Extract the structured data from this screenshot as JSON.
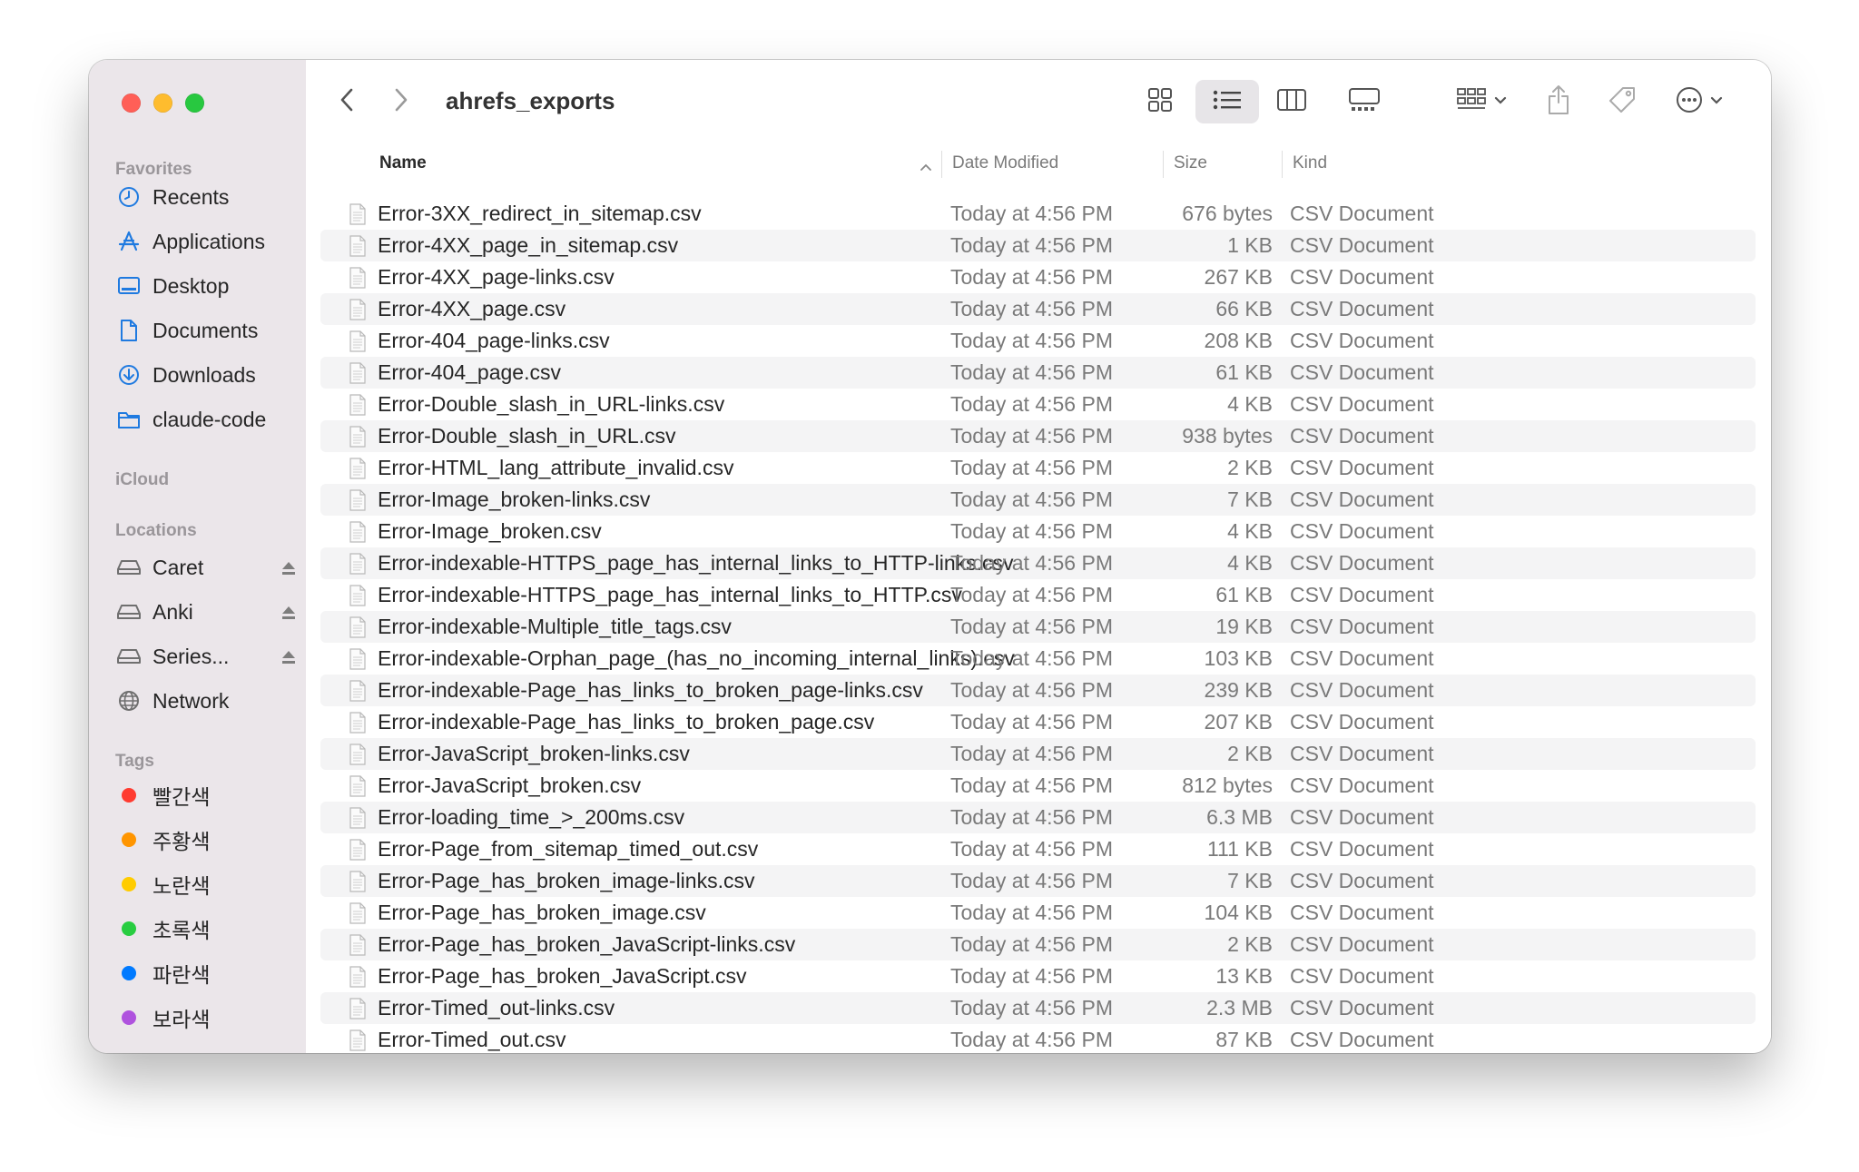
{
  "window": {
    "title": "ahrefs_exports"
  },
  "sidebar": {
    "favorites_label": "Favorites",
    "favorites": [
      {
        "label": "Recents",
        "icon": "clock-icon"
      },
      {
        "label": "Applications",
        "icon": "applications-icon"
      },
      {
        "label": "Desktop",
        "icon": "desktop-icon"
      },
      {
        "label": "Documents",
        "icon": "document-icon"
      },
      {
        "label": "Downloads",
        "icon": "download-icon"
      },
      {
        "label": "claude-code",
        "icon": "folder-icon"
      }
    ],
    "icloud_label": "iCloud",
    "locations_label": "Locations",
    "locations": [
      {
        "label": "Caret",
        "icon": "drive-icon",
        "ejectable": true
      },
      {
        "label": "Anki",
        "icon": "drive-icon",
        "ejectable": true
      },
      {
        "label": "Series...",
        "icon": "drive-icon",
        "ejectable": true
      },
      {
        "label": "Network",
        "icon": "globe-icon",
        "ejectable": false
      }
    ],
    "tags_label": "Tags",
    "tags": [
      {
        "label": "빨간색",
        "color": "#ff3b30"
      },
      {
        "label": "주황색",
        "color": "#ff9500"
      },
      {
        "label": "노란색",
        "color": "#ffcc00"
      },
      {
        "label": "초록색",
        "color": "#28cd41"
      },
      {
        "label": "파란색",
        "color": "#007aff"
      },
      {
        "label": "보라색",
        "color": "#af52de"
      }
    ]
  },
  "columns": {
    "name": "Name",
    "date": "Date Modified",
    "size": "Size",
    "kind": "Kind"
  },
  "files": [
    {
      "name": "Error-3XX_redirect_in_sitemap.csv",
      "date": "Today at 4:56 PM",
      "size": "676 bytes",
      "kind": "CSV Document"
    },
    {
      "name": "Error-4XX_page_in_sitemap.csv",
      "date": "Today at 4:56 PM",
      "size": "1 KB",
      "kind": "CSV Document"
    },
    {
      "name": "Error-4XX_page-links.csv",
      "date": "Today at 4:56 PM",
      "size": "267 KB",
      "kind": "CSV Document"
    },
    {
      "name": "Error-4XX_page.csv",
      "date": "Today at 4:56 PM",
      "size": "66 KB",
      "kind": "CSV Document"
    },
    {
      "name": "Error-404_page-links.csv",
      "date": "Today at 4:56 PM",
      "size": "208 KB",
      "kind": "CSV Document"
    },
    {
      "name": "Error-404_page.csv",
      "date": "Today at 4:56 PM",
      "size": "61 KB",
      "kind": "CSV Document"
    },
    {
      "name": "Error-Double_slash_in_URL-links.csv",
      "date": "Today at 4:56 PM",
      "size": "4 KB",
      "kind": "CSV Document"
    },
    {
      "name": "Error-Double_slash_in_URL.csv",
      "date": "Today at 4:56 PM",
      "size": "938 bytes",
      "kind": "CSV Document"
    },
    {
      "name": "Error-HTML_lang_attribute_invalid.csv",
      "date": "Today at 4:56 PM",
      "size": "2 KB",
      "kind": "CSV Document"
    },
    {
      "name": "Error-Image_broken-links.csv",
      "date": "Today at 4:56 PM",
      "size": "7 KB",
      "kind": "CSV Document"
    },
    {
      "name": "Error-Image_broken.csv",
      "date": "Today at 4:56 PM",
      "size": "4 KB",
      "kind": "CSV Document"
    },
    {
      "name": "Error-indexable-HTTPS_page_has_internal_links_to_HTTP-links.csv",
      "date": "Today at 4:56 PM",
      "size": "4 KB",
      "kind": "CSV Document"
    },
    {
      "name": "Error-indexable-HTTPS_page_has_internal_links_to_HTTP.csv",
      "date": "Today at 4:56 PM",
      "size": "61 KB",
      "kind": "CSV Document"
    },
    {
      "name": "Error-indexable-Multiple_title_tags.csv",
      "date": "Today at 4:56 PM",
      "size": "19 KB",
      "kind": "CSV Document"
    },
    {
      "name": "Error-indexable-Orphan_page_(has_no_incoming_internal_links).csv",
      "date": "Today at 4:56 PM",
      "size": "103 KB",
      "kind": "CSV Document"
    },
    {
      "name": "Error-indexable-Page_has_links_to_broken_page-links.csv",
      "date": "Today at 4:56 PM",
      "size": "239 KB",
      "kind": "CSV Document"
    },
    {
      "name": "Error-indexable-Page_has_links_to_broken_page.csv",
      "date": "Today at 4:56 PM",
      "size": "207 KB",
      "kind": "CSV Document"
    },
    {
      "name": "Error-JavaScript_broken-links.csv",
      "date": "Today at 4:56 PM",
      "size": "2 KB",
      "kind": "CSV Document"
    },
    {
      "name": "Error-JavaScript_broken.csv",
      "date": "Today at 4:56 PM",
      "size": "812 bytes",
      "kind": "CSV Document"
    },
    {
      "name": "Error-loading_time_>_200ms.csv",
      "date": "Today at 4:56 PM",
      "size": "6.3 MB",
      "kind": "CSV Document"
    },
    {
      "name": "Error-Page_from_sitemap_timed_out.csv",
      "date": "Today at 4:56 PM",
      "size": "111 KB",
      "kind": "CSV Document"
    },
    {
      "name": "Error-Page_has_broken_image-links.csv",
      "date": "Today at 4:56 PM",
      "size": "7 KB",
      "kind": "CSV Document"
    },
    {
      "name": "Error-Page_has_broken_image.csv",
      "date": "Today at 4:56 PM",
      "size": "104 KB",
      "kind": "CSV Document"
    },
    {
      "name": "Error-Page_has_broken_JavaScript-links.csv",
      "date": "Today at 4:56 PM",
      "size": "2 KB",
      "kind": "CSV Document"
    },
    {
      "name": "Error-Page_has_broken_JavaScript.csv",
      "date": "Today at 4:56 PM",
      "size": "13 KB",
      "kind": "CSV Document"
    },
    {
      "name": "Error-Timed_out-links.csv",
      "date": "Today at 4:56 PM",
      "size": "2.3 MB",
      "kind": "CSV Document"
    },
    {
      "name": "Error-Timed_out.csv",
      "date": "Today at 4:56 PM",
      "size": "87 KB",
      "kind": "CSV Document"
    }
  ]
}
